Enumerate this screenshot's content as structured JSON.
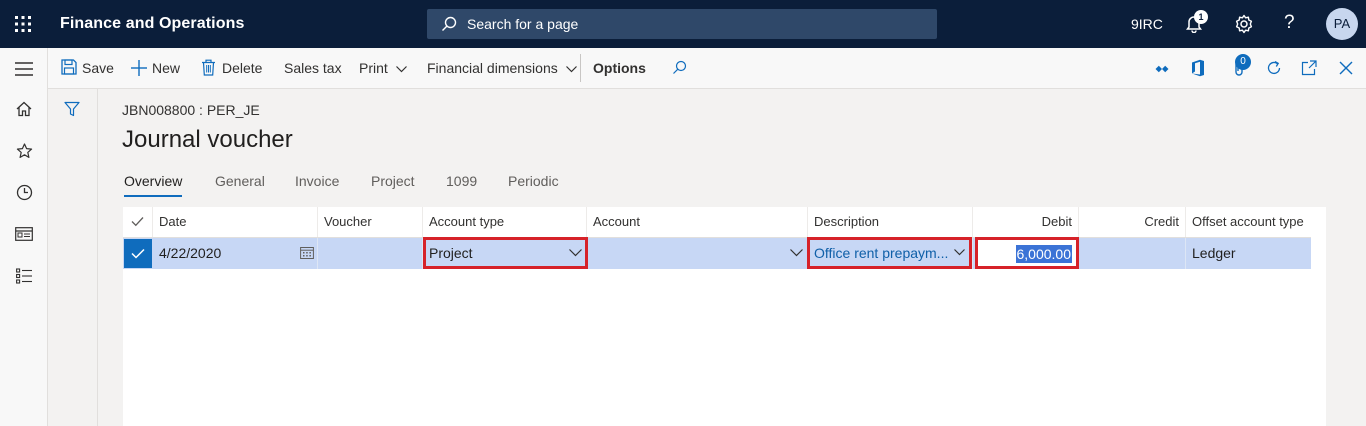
{
  "app": {
    "title": "Finance and Operations",
    "search_placeholder": "Search for a page",
    "company": "9IRC",
    "notification_count": "1",
    "user_initials": "PA"
  },
  "actions": {
    "save": "Save",
    "new": "New",
    "delete": "Delete",
    "sales_tax": "Sales tax",
    "print": "Print",
    "financial_dimensions": "Financial dimensions",
    "options": "Options",
    "attachments_count": "0"
  },
  "page": {
    "breadcrumb": "JBN008800 : PER_JE",
    "title": "Journal voucher"
  },
  "tabs": [
    "Overview",
    "General",
    "Invoice",
    "Project",
    "1099",
    "Periodic"
  ],
  "grid": {
    "columns": {
      "date": "Date",
      "voucher": "Voucher",
      "account_type": "Account type",
      "account": "Account",
      "description": "Description",
      "debit": "Debit",
      "credit": "Credit",
      "offset_account_type": "Offset account type"
    },
    "rows": [
      {
        "date": "4/22/2020",
        "voucher": "",
        "account_type": "Project",
        "account": "",
        "description": "Office rent prepaym...",
        "debit": "6,000.00",
        "credit": "",
        "offset_account_type": "Ledger"
      }
    ]
  },
  "colors": {
    "nav_bg": "#0b1e3a",
    "accent": "#0f6cbd",
    "selected_row": "#c7d7f5",
    "highlight_border": "#d62229"
  }
}
